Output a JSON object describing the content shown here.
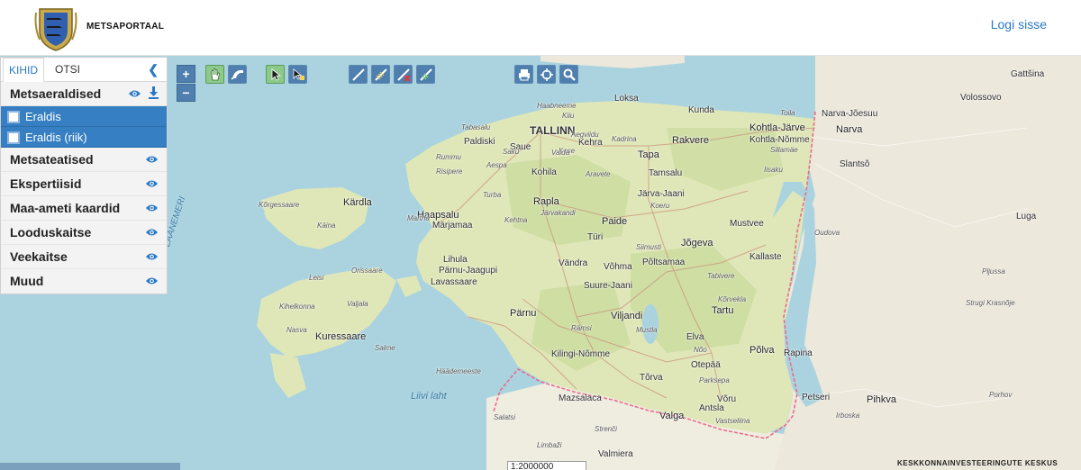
{
  "header": {
    "brand": "METSAPORTAAL",
    "login": "Logi sisse"
  },
  "panel": {
    "tabs": [
      "KIHID",
      "OTSI"
    ],
    "groups": [
      {
        "label": "Metsaeraldised"
      },
      {
        "label": "Metsateatised"
      },
      {
        "label": "Ekspertiisid"
      },
      {
        "label": "Maa-ameti kaardid"
      },
      {
        "label": "Looduskaitse"
      },
      {
        "label": "Veekaitse"
      },
      {
        "label": "Muud"
      }
    ],
    "sublayers": [
      "Eraldis",
      "Eraldis (riik)"
    ]
  },
  "toolbar": {
    "zoom_in": "+",
    "zoom_out": "−"
  },
  "map": {
    "scale": "1:2000000",
    "attribution": "KESKKONNAINVESTEERINGUTE KESKUS",
    "labels": [
      {
        "t": "TALLINN",
        "c": "city"
      },
      {
        "t": "Haabneeme",
        "c": "small"
      },
      {
        "t": "Kiiu",
        "c": "small"
      },
      {
        "t": "Loksa",
        "c": "place"
      },
      {
        "t": "Kunda",
        "c": "place"
      },
      {
        "t": "Toila",
        "c": "small"
      },
      {
        "t": "Narva-Jõesuu",
        "c": "place"
      },
      {
        "t": "Narva",
        "c": "big"
      },
      {
        "t": "Kohtla-Järve",
        "c": "big"
      },
      {
        "t": "Kohtla-Nõmme",
        "c": "place"
      },
      {
        "t": "Rakvere",
        "c": "big"
      },
      {
        "t": "Kadrina",
        "c": "small"
      },
      {
        "t": "Kehra",
        "c": "place"
      },
      {
        "t": "Saue",
        "c": "place"
      },
      {
        "t": "Paldiski",
        "c": "place"
      },
      {
        "t": "Tabasalu",
        "c": "small"
      },
      {
        "t": "Saku",
        "c": "small"
      },
      {
        "t": "Kose",
        "c": "small"
      },
      {
        "t": "Aegviidu",
        "c": "small"
      },
      {
        "t": "Vaida",
        "c": "small"
      },
      {
        "t": "Kohila",
        "c": "place"
      },
      {
        "t": "Tapa",
        "c": "big"
      },
      {
        "t": "Tamsalu",
        "c": "place"
      },
      {
        "t": "Aravete",
        "c": "small"
      },
      {
        "t": "Järva-Jaani",
        "c": "place"
      },
      {
        "t": "Rummu",
        "c": "small"
      },
      {
        "t": "Aespa",
        "c": "small"
      },
      {
        "t": "Risipere",
        "c": "small"
      },
      {
        "t": "Turba",
        "c": "small"
      },
      {
        "t": "Rapla",
        "c": "big"
      },
      {
        "t": "Järvakandi",
        "c": "small"
      },
      {
        "t": "Kehtna",
        "c": "small"
      },
      {
        "t": "Paide",
        "c": "big"
      },
      {
        "t": "Türi",
        "c": "place"
      },
      {
        "t": "Koeru",
        "c": "small"
      },
      {
        "t": "Iisaku",
        "c": "small"
      },
      {
        "t": "Sillamäe",
        "c": "small"
      },
      {
        "t": "Kärdla",
        "c": "big"
      },
      {
        "t": "Kõrgessaare",
        "c": "small"
      },
      {
        "t": "Käina",
        "c": "small"
      },
      {
        "t": "Haapsalu",
        "c": "big"
      },
      {
        "t": "Martna",
        "c": "small"
      },
      {
        "t": "Märjamaa",
        "c": "place"
      },
      {
        "t": "Mustvee",
        "c": "place"
      },
      {
        "t": "Jõgeva",
        "c": "big"
      },
      {
        "t": "Siimusti",
        "c": "small"
      },
      {
        "t": "Põltsamaa",
        "c": "place"
      },
      {
        "t": "Kallaste",
        "c": "place"
      },
      {
        "t": "Lihula",
        "c": "place"
      },
      {
        "t": "Pärnu-Jaagupi",
        "c": "place"
      },
      {
        "t": "Lavassaare",
        "c": "place"
      },
      {
        "t": "Vändra",
        "c": "place"
      },
      {
        "t": "Võhma",
        "c": "place"
      },
      {
        "t": "Tabivere",
        "c": "small"
      },
      {
        "t": "Suure-Jaani",
        "c": "place"
      },
      {
        "t": "Kõrvekla",
        "c": "small"
      },
      {
        "t": "Tartu",
        "c": "big"
      },
      {
        "t": "Pärnu",
        "c": "big"
      },
      {
        "t": "Viljandi",
        "c": "big"
      },
      {
        "t": "Leisi",
        "c": "small"
      },
      {
        "t": "Orissaare",
        "c": "small"
      },
      {
        "t": "Kihelkonna",
        "c": "small"
      },
      {
        "t": "Valjala",
        "c": "small"
      },
      {
        "t": "Kuressaare",
        "c": "big"
      },
      {
        "t": "Nasva",
        "c": "small"
      },
      {
        "t": "Salme",
        "c": "small"
      },
      {
        "t": "Häädemeeste",
        "c": "small"
      },
      {
        "t": "Kilingi-Nõmme",
        "c": "place"
      },
      {
        "t": "Mustla",
        "c": "small"
      },
      {
        "t": "Rämsi",
        "c": "small"
      },
      {
        "t": "Elva",
        "c": "place"
      },
      {
        "t": "Nõo",
        "c": "small"
      },
      {
        "t": "Põlva",
        "c": "big"
      },
      {
        "t": "Rapina",
        "c": "place"
      },
      {
        "t": "Otepää",
        "c": "place"
      },
      {
        "t": "Tõrva",
        "c": "place"
      },
      {
        "t": "Parksepa",
        "c": "small"
      },
      {
        "t": "Võru",
        "c": "place"
      },
      {
        "t": "Petseri",
        "c": "place"
      },
      {
        "t": "Valga",
        "c": "big"
      },
      {
        "t": "Antsla",
        "c": "place"
      },
      {
        "t": "Vastseliina",
        "c": "small"
      },
      {
        "t": "Mazsalaca",
        "c": "place"
      },
      {
        "t": "Salatsi",
        "c": "small"
      },
      {
        "t": "Strenči",
        "c": "small"
      },
      {
        "t": "Limbaži",
        "c": "small"
      },
      {
        "t": "Valmiera",
        "c": "place"
      },
      {
        "t": "Volossovo",
        "c": "place"
      },
      {
        "t": "Gattšina",
        "c": "place"
      },
      {
        "t": "Slantsõ",
        "c": "place"
      },
      {
        "t": "Luga",
        "c": "place"
      },
      {
        "t": "Oudova",
        "c": "small"
      },
      {
        "t": "Pljussa",
        "c": "small"
      },
      {
        "t": "Strugi Krasnõje",
        "c": "small"
      },
      {
        "t": "Pihkva",
        "c": "big"
      },
      {
        "t": "Porhov",
        "c": "small"
      },
      {
        "t": "Irboska",
        "c": "small"
      }
    ],
    "water_labels": [
      "Liivi laht",
      "LÄÄNEMERI"
    ]
  },
  "colors": {
    "accent": "#2a78c5",
    "selected": "#357fc2",
    "water": "#aad3df",
    "land": "#e8ecc9",
    "forest": "#cfe0a6",
    "border": "#e86d8c"
  }
}
